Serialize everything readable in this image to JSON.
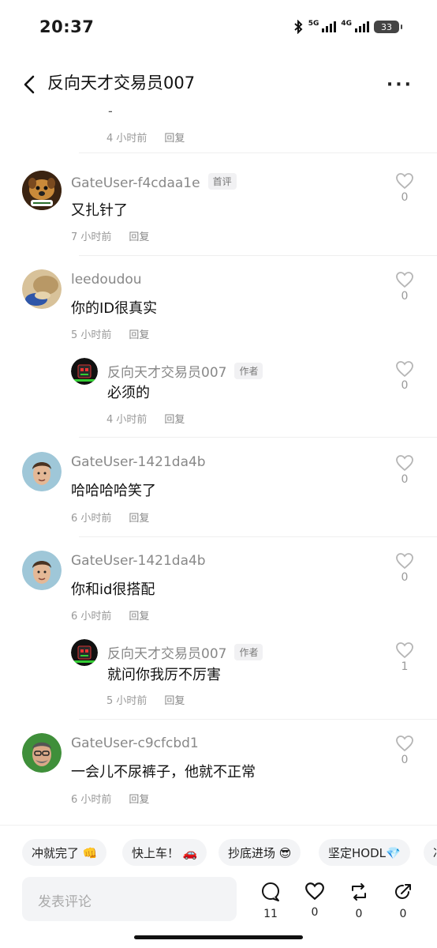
{
  "status": {
    "time": "20:37",
    "net1": "5G",
    "net2": "4G",
    "battery": "33"
  },
  "header": {
    "title": "反向天才交易员007"
  },
  "top_remnant": {
    "text": "-",
    "time": "4 小时前",
    "reply": "回复"
  },
  "comments": [
    {
      "name": "GateUser-f4cdaa1e",
      "tag": "首评",
      "text": "又扎针了",
      "time": "7 小时前",
      "reply": "回复",
      "likes": "0"
    },
    {
      "name": "leedoudou",
      "text": "你的ID很真实",
      "time": "5 小时前",
      "reply": "回复",
      "likes": "0"
    },
    {
      "name": "反向天才交易员007",
      "tag": "作者",
      "text": "必须的",
      "time": "4 小时前",
      "reply": "回复",
      "likes": "0"
    },
    {
      "name": "GateUser-1421da4b",
      "text": "哈哈哈哈笑了",
      "time": "6 小时前",
      "reply": "回复",
      "likes": "0"
    },
    {
      "name": "GateUser-1421da4b",
      "text": "你和id很搭配",
      "time": "6 小时前",
      "reply": "回复",
      "likes": "0"
    },
    {
      "name": "反向天才交易员007",
      "tag": "作者",
      "text": "就问你我厉不厉害",
      "time": "5 小时前",
      "reply": "回复",
      "likes": "1"
    },
    {
      "name": "GateUser-c9cfcbd1",
      "text": "一会儿不尿裤子，他就不正常",
      "time": "6 小时前",
      "reply": "回复",
      "likes": "0"
    }
  ],
  "chips": [
    "冲就完了 👊",
    "快上车！ 🚗",
    "抄底进场 😎",
    "坚定HODL💎",
    "冲"
  ],
  "composer": {
    "placeholder": "发表评论"
  },
  "bottom_bar": {
    "comments": "11",
    "likes": "0",
    "reposts": "0",
    "shares": "0"
  }
}
